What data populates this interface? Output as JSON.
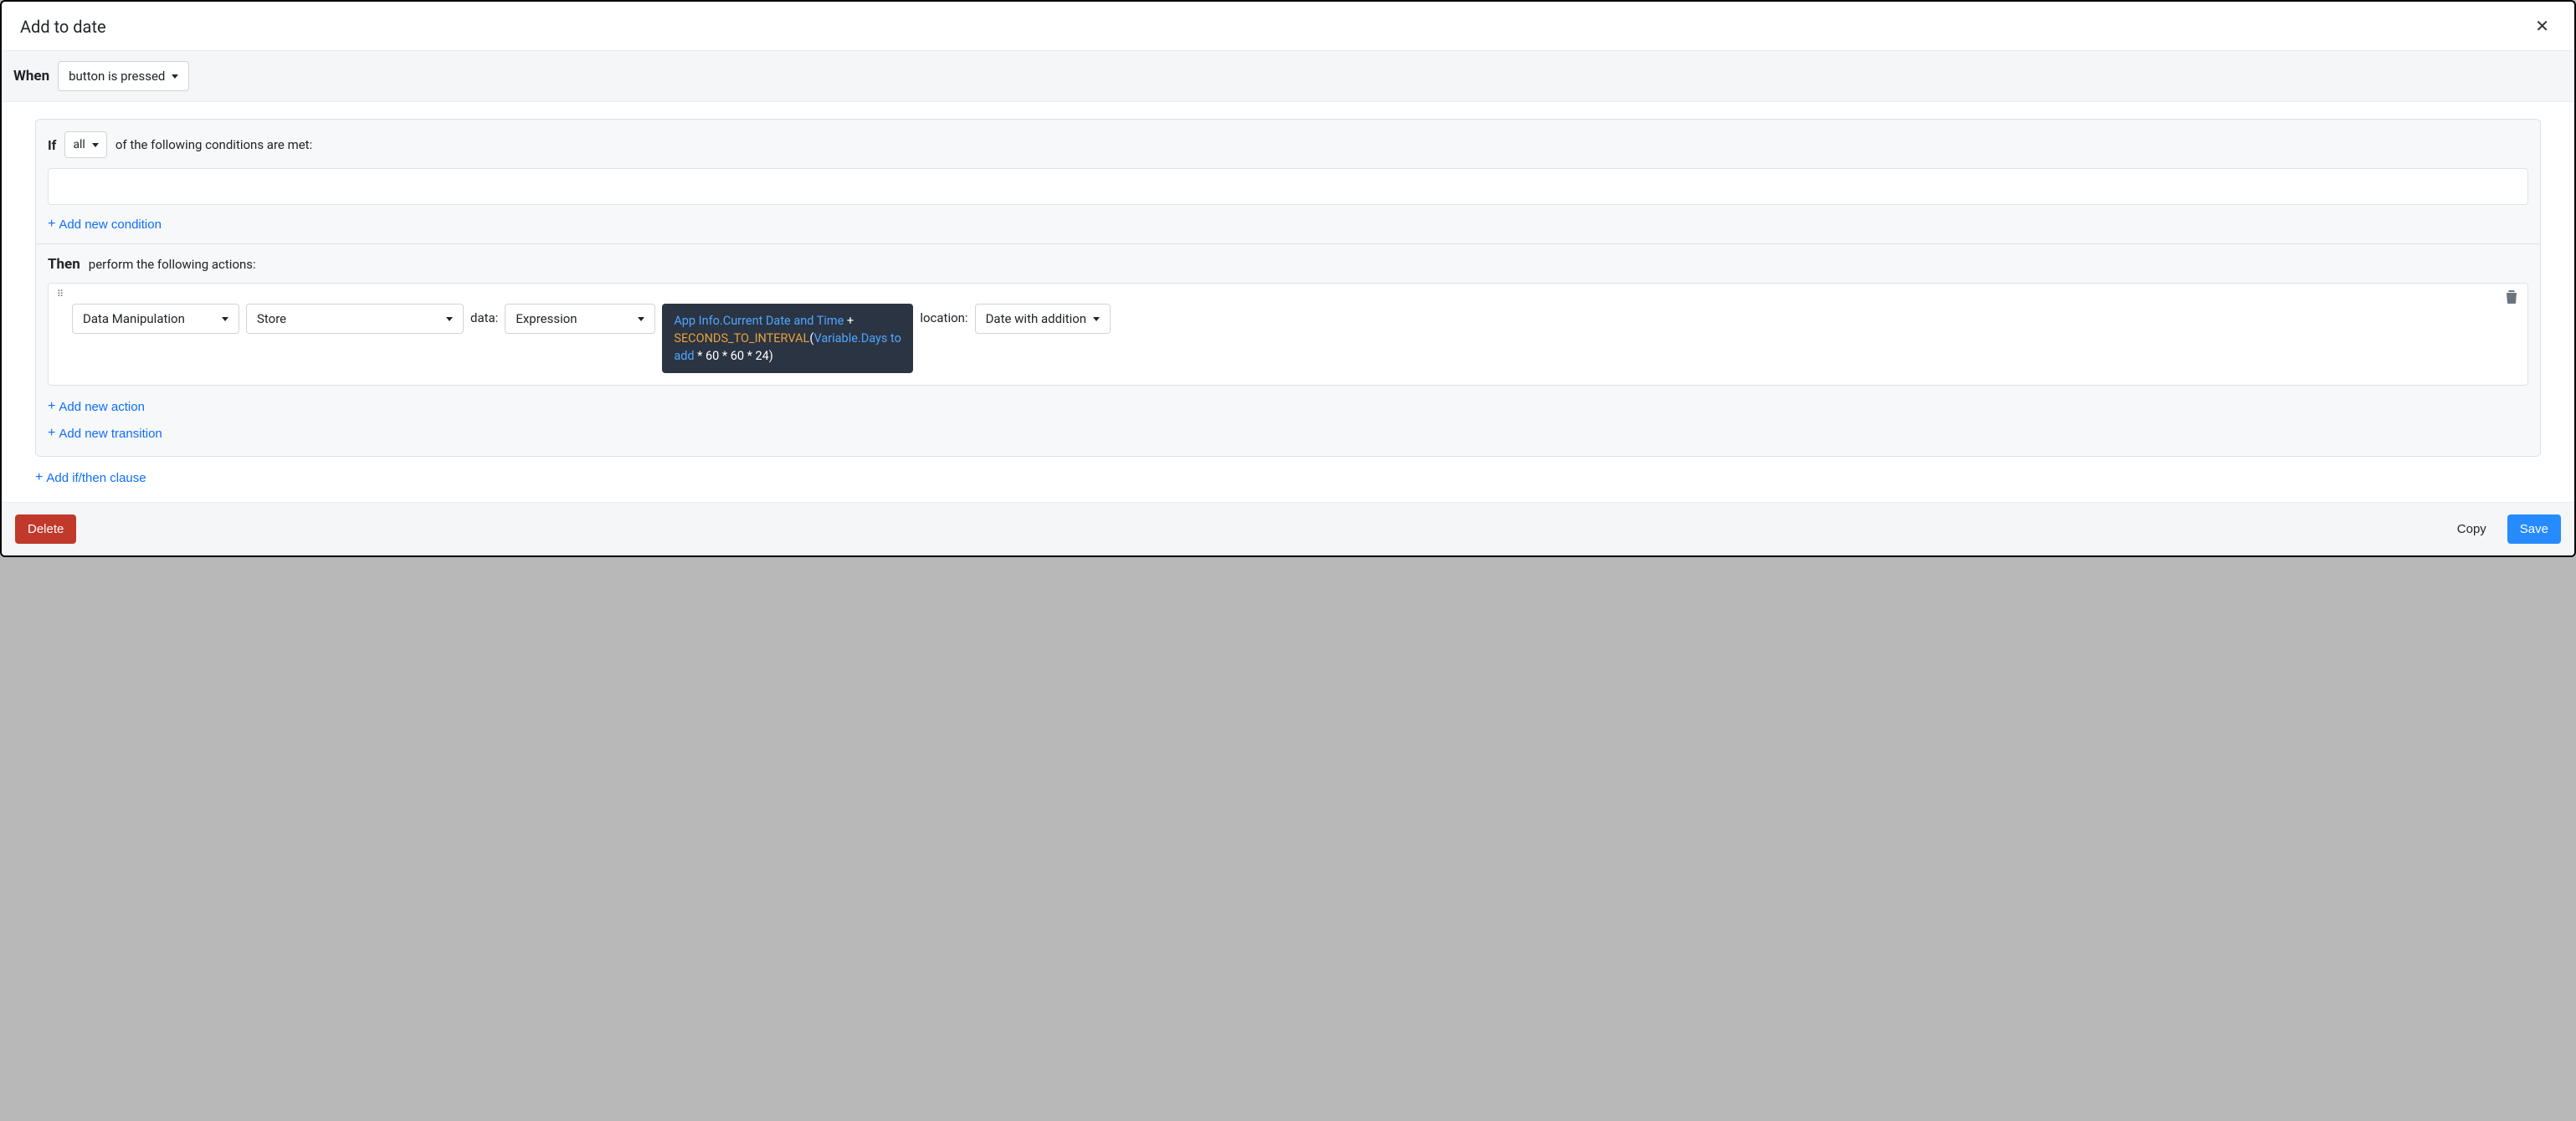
{
  "header": {
    "title": "Add to date"
  },
  "when": {
    "label": "When",
    "trigger": "button is pressed"
  },
  "if": {
    "label": "If",
    "scope": "all",
    "suffix": "of the following conditions are met:",
    "add_condition": "Add new condition"
  },
  "then": {
    "label": "Then",
    "suffix": "perform the following actions:",
    "action": {
      "category": "Data Manipulation",
      "operation": "Store",
      "data_label": "data:",
      "data_select": "Expression",
      "expr": {
        "token1": "App Info.Current Date and Time",
        "plus": " + ",
        "func": "SECONDS_TO_INTERVAL",
        "lparen": "(",
        "var": "Variable.Days to add",
        "tail": " * 60 * 60 * 24)"
      },
      "location_label": "location:",
      "location_value": "Date with addition"
    },
    "add_action": "Add new action",
    "add_transition": "Add new transition"
  },
  "add_ifthen": "Add if/then clause",
  "footer": {
    "delete": "Delete",
    "copy": "Copy",
    "save": "Save"
  }
}
